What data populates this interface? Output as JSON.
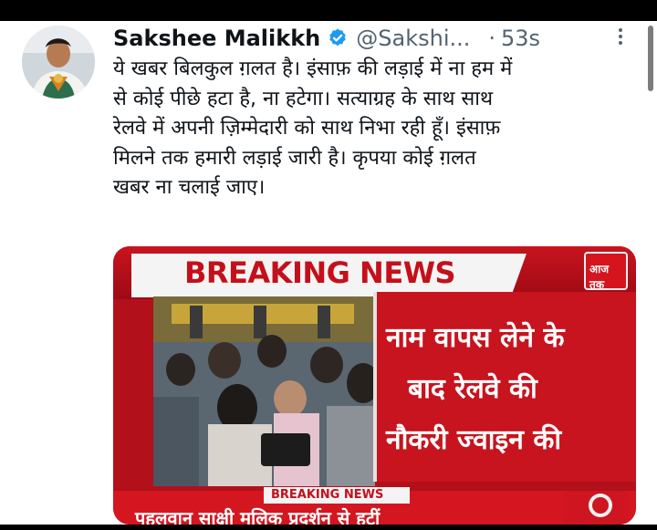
{
  "tweet": {
    "display_name": "Sakshee Malikkh",
    "handle": "@Sakshi...",
    "separator": "·",
    "time": "53s",
    "text_lines": [
      "ये खबर बिलकुल ग़लत है। इंसाफ़ की लड़ाई में ना हम में",
      "से कोई पीछे हटा है, ना हटेगा। सत्याग्रह के साथ साथ",
      "रेलवे में अपनी ज़िम्मेदारी को साथ निभा रही हूँ। इंसाफ़",
      "मिलने तक हमारी लड़ाई जारी है। कृपया कोई ग़लत",
      "खबर ना चलाई जाए।"
    ]
  },
  "media": {
    "banner": "BREAKING NEWS",
    "logo_text": "आज तक",
    "caption_lines": [
      "नाम वापस लेने के",
      "बाद रेलवे की",
      "नौकरी ज्वाइन की"
    ],
    "ticker_label": "BREAKING NEWS",
    "ticker_text": "पहलवान साक्षी मलिक प्रदर्शन से हटीं"
  },
  "colors": {
    "verified_badge": "#1d9bf0",
    "news_red": "#c7141e",
    "secondary_text": "#536471"
  },
  "icons": {
    "verified": "verified-badge-icon",
    "more": "more-dots-icon"
  }
}
